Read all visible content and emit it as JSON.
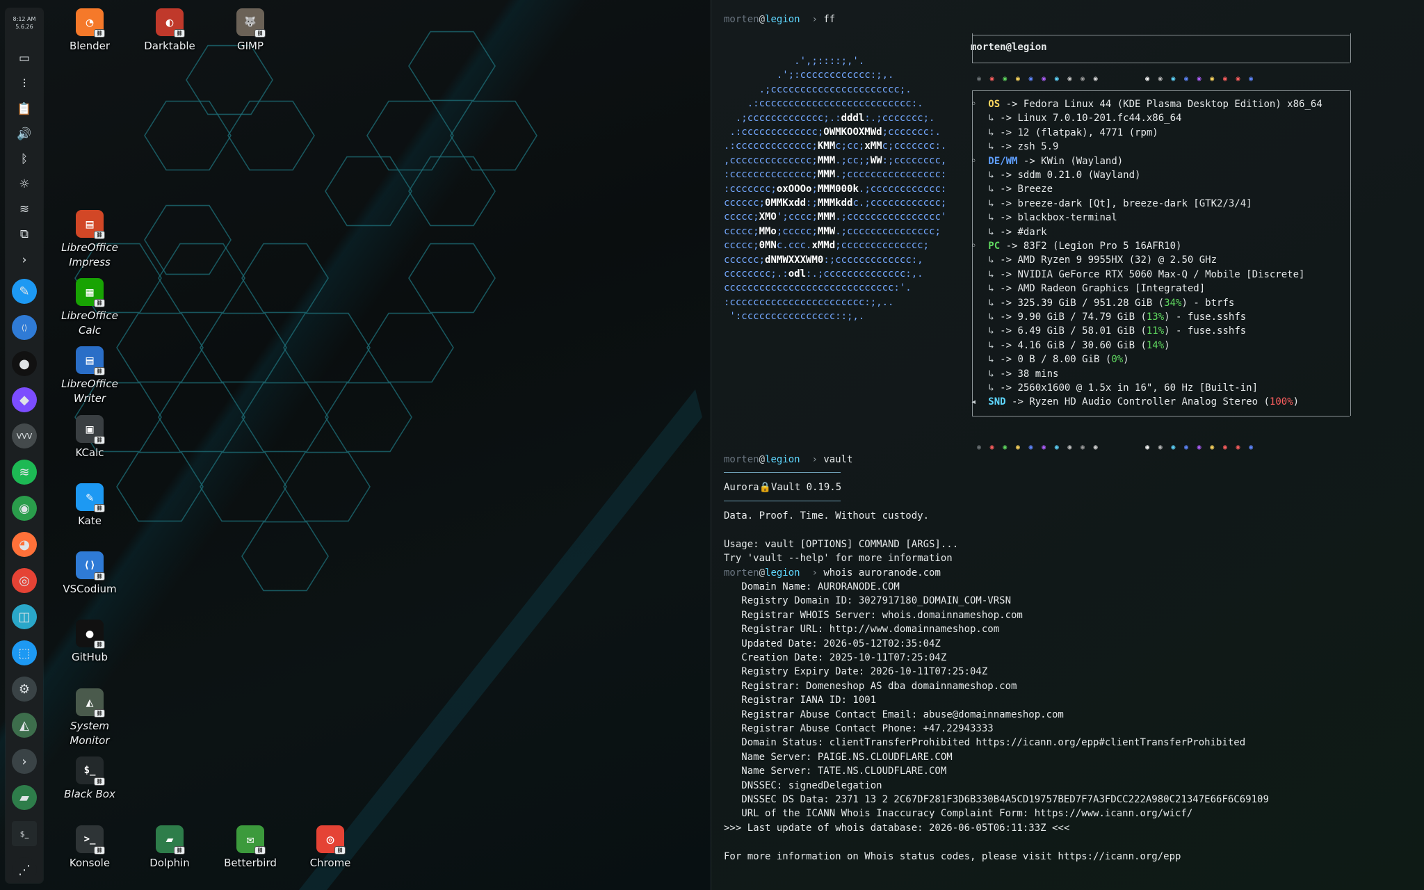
{
  "panel": {
    "clock_time": "8:12 AM",
    "clock_date": "5.6.26",
    "items": [
      {
        "name": "show-desktop-icon",
        "glyph": "▭"
      },
      {
        "name": "mixer-icon",
        "glyph": "⫶"
      },
      {
        "name": "clipboard-icon",
        "glyph": "📋"
      },
      {
        "name": "volume-icon",
        "glyph": "🔊"
      },
      {
        "name": "bluetooth-icon",
        "glyph": "ᛒ"
      },
      {
        "name": "brightness-icon",
        "glyph": "☼"
      },
      {
        "name": "wifi-icon",
        "glyph": "≋"
      },
      {
        "name": "display-icon",
        "glyph": "⧉"
      },
      {
        "name": "expand-arrow-icon",
        "glyph": "›"
      }
    ],
    "apps": [
      {
        "name": "kate-app-icon",
        "glyph": "✎",
        "color": "#1d99f3"
      },
      {
        "name": "vscodium-app-icon",
        "glyph": "⟨⟩",
        "color": "#2f7bd6"
      },
      {
        "name": "github-app-icon",
        "glyph": "●",
        "color": "#111111"
      },
      {
        "name": "obsidian-app-icon",
        "glyph": "◆",
        "color": "#7c4dff"
      },
      {
        "name": "vim-app-icon",
        "glyph": "VVV",
        "color": "#444a4c"
      },
      {
        "name": "spotify-app-icon",
        "glyph": "≋",
        "color": "#1db954"
      },
      {
        "name": "kdeconnect-app-icon",
        "glyph": "◉",
        "color": "#2a9d4b"
      },
      {
        "name": "firefox-app-icon",
        "glyph": "◕",
        "color": "#ff7139"
      },
      {
        "name": "chrome-app-icon",
        "glyph": "◎",
        "color": "#e54335"
      },
      {
        "name": "screenshot-app-icon",
        "glyph": "◫",
        "color": "#2aa7c9"
      },
      {
        "name": "discover-app-icon",
        "glyph": "⬚",
        "color": "#1d99f3"
      },
      {
        "name": "settings-app-icon",
        "glyph": "⚙",
        "color": "#3a4346"
      },
      {
        "name": "system-monitor-app-icon",
        "glyph": "◭",
        "color": "#3d6e4c"
      },
      {
        "name": "terminal-arrow-app-icon",
        "glyph": "›",
        "color": "#3a4346"
      },
      {
        "name": "dolphin-app-icon",
        "glyph": "▰",
        "color": "#2e7d4a"
      },
      {
        "name": "blackbox-app-icon",
        "glyph": "$_",
        "color": "#23292b"
      },
      {
        "name": "launcher-app-icon",
        "glyph": "⋰",
        "color": "#1b1f21"
      }
    ]
  },
  "desktop": {
    "icons": [
      {
        "label": "Blender",
        "glyph": "◔",
        "color": "#f5792a"
      },
      {
        "label": "Darktable",
        "glyph": "◐",
        "color": "#c0392b"
      },
      {
        "label": "GIMP",
        "glyph": "🐺",
        "color": "#6b6257"
      },
      {
        "label": "LibreOffice\nImpress",
        "glyph": "▤",
        "color": "#d24726"
      },
      {
        "label": "LibreOffice\nCalc",
        "glyph": "▦",
        "color": "#18a303"
      },
      {
        "label": "LibreOffice\nWriter",
        "glyph": "▤",
        "color": "#2a6ec7"
      },
      {
        "label": "KCalc",
        "glyph": "▣",
        "color": "#3a3f42"
      },
      {
        "label": "Kate",
        "glyph": "✎",
        "color": "#1d99f3"
      },
      {
        "label": "VSCodium",
        "glyph": "⟨⟩",
        "color": "#2f7bd6"
      },
      {
        "label": "GitHub",
        "glyph": "●",
        "color": "#111111"
      },
      {
        "label": "System\nMonitor",
        "glyph": "◭",
        "color": "#4a5a4c"
      },
      {
        "label": "Black Box",
        "glyph": "$_",
        "color": "#23292b"
      },
      {
        "label": "Konsole",
        "glyph": ">_",
        "color": "#2e3436"
      },
      {
        "label": "Dolphin",
        "glyph": "▰",
        "color": "#2e7d4a"
      },
      {
        "label": "Betterbird",
        "glyph": "✉",
        "color": "#3c9a3c"
      },
      {
        "label": "Chrome",
        "glyph": "◎",
        "color": "#e54335"
      }
    ]
  },
  "terminal": {
    "prompt": {
      "user": "morten",
      "at": "@",
      "host": "legion",
      "arrow": "›"
    },
    "cmd_ff": "ff",
    "ff": {
      "header": "morten@legion",
      "logo": [
        "            .',;::::;,'.",
        "         .';:cccccccccccc:;,.",
        "      .;cccccccccccccccccccccc;.",
        "    .:cccccccccccccccccccccccccc:.",
        "  .;ccccccccccccc;.:dddl:.;ccccccc;.",
        " .:ccccccccccccc;OWMKOOXMWd;ccccccc:.",
        ".:ccccccccccccc;KMMc;cc;xMMc;ccccccc:.",
        ",cccccccccccccc;MMM.;cc;;WW:;cccccccc,",
        ":cccccccccccccc;MMM.;cccccccccccccccc:",
        ":ccccccc;oxOOOo;MMM000k.;cccccccccccc:",
        "cccccc;0MMKxdd:;MMMkddc.;cccccccccccc;",
        "ccccc;XMO';cccc;MMM.;cccccccccccccccc'",
        "ccccc;MMo;ccccc;MMW.;ccccccccccccccc;",
        "ccccc;0MNc.ccc.xMMd;cccccccccccccc;",
        "cccccc;dNMWXXXWM0:;ccccccccccccc:,",
        "cccccccc;.:odl:.;cccccccccccccc:,.",
        "ccccccccccccccccccccccccccccc:'.",
        ":ccccccccccccccccccccccc:;,..",
        " ':cccccccccccccccc::;,."
      ],
      "rows": [
        {
          "label": "OS",
          "cls": "lbl-os",
          "text": "-> Fedora Linux 44 (KDE Plasma Desktop Edition) x86_64"
        },
        {
          "label": "",
          "text": "-> Linux 7.0.10-201.fc44.x86_64"
        },
        {
          "label": "",
          "text": "-> 12 (flatpak), 4771 (rpm)"
        },
        {
          "label": "",
          "text": "-> zsh 5.9"
        },
        {
          "label": "DE/WM",
          "cls": "lbl-de",
          "text": "-> KWin (Wayland)"
        },
        {
          "label": "",
          "text": "-> sddm 0.21.0 (Wayland)"
        },
        {
          "label": "",
          "text": "-> Breeze"
        },
        {
          "label": "",
          "text": "-> breeze-dark [Qt], breeze-dark [GTK2/3/4]"
        },
        {
          "label": "",
          "text": "-> blackbox-terminal"
        },
        {
          "label": "",
          "text": "-> #dark"
        },
        {
          "label": "PC",
          "cls": "lbl-pc",
          "text": "-> 83F2 (Legion Pro 5 16AFR10)"
        },
        {
          "label": "",
          "text": "-> AMD Ryzen 9 9955HX (32) @ 2.50 GHz"
        },
        {
          "label": "",
          "text": "-> NVIDIA GeForce RTX 5060 Max-Q / Mobile [Discrete]"
        },
        {
          "label": "",
          "text": "-> AMD Radeon Graphics [Integrated]"
        },
        {
          "label": "",
          "text": "-> 325.39 GiB / 951.28 GiB (",
          "pct": "34%",
          "pcls": "pct-g",
          "tail": ") - btrfs"
        },
        {
          "label": "",
          "text": "-> 9.90 GiB / 74.79 GiB (",
          "pct": "13%",
          "pcls": "pct-g",
          "tail": ") - fuse.sshfs"
        },
        {
          "label": "",
          "text": "-> 6.49 GiB / 58.01 GiB (",
          "pct": "11%",
          "pcls": "pct-g",
          "tail": ") - fuse.sshfs"
        },
        {
          "label": "",
          "text": "-> 4.16 GiB / 30.60 GiB (",
          "pct": "14%",
          "pcls": "pct-g",
          "tail": ")"
        },
        {
          "label": "",
          "text": "-> 0 B / 8.00 GiB (",
          "pct": "0%",
          "pcls": "pct-g",
          "tail": ")"
        },
        {
          "label": "",
          "text": "-> 38 mins"
        },
        {
          "label": "",
          "text": "-> 2560x1600 @ 1.5x in 16\", 60 Hz [Built-in]"
        },
        {
          "label": "SND",
          "cls": "lbl-snd",
          "text": "-> Ryzen HD Audio Controller Analog Stereo (",
          "pct": "100%",
          "pcls": "pct-r",
          "tail": ")"
        }
      ],
      "palette": [
        "#6b7275",
        "#ff5f5f",
        "#5fd75f",
        "#ffd75f",
        "#5f87ff",
        "#af5fff",
        "#5fd7ff",
        "#c6c6c6",
        "#9e9e9e",
        "#dadada",
        "#ffffff",
        "#bcbcbc",
        "#5fd7ff",
        "#5f87ff",
        "#af5fff",
        "#ffd75f",
        "#ff5f5f",
        "#ff5f5f",
        "#5f87ff"
      ]
    },
    "cmd_vault": "vault",
    "vault": {
      "title": "Aurora🔒Vault 0.19.5",
      "tagline": "Data. Proof. Time. Without custody.",
      "usage": "Usage: vault [OPTIONS] COMMAND [ARGS]...",
      "help": "Try 'vault --help' for more information"
    },
    "cmd_whois": "whois auroranode.com",
    "whois": [
      "   Domain Name: AURORANODE.COM",
      "   Registry Domain ID: 3027917180_DOMAIN_COM-VRSN",
      "   Registrar WHOIS Server: whois.domainnameshop.com",
      "   Registrar URL: http://www.domainnameshop.com",
      "   Updated Date: 2026-05-12T02:35:04Z",
      "   Creation Date: 2025-10-11T07:25:04Z",
      "   Registry Expiry Date: 2026-10-11T07:25:04Z",
      "   Registrar: Domeneshop AS dba domainnameshop.com",
      "   Registrar IANA ID: 1001",
      "   Registrar Abuse Contact Email: abuse@domainnameshop.com",
      "   Registrar Abuse Contact Phone: +47.22943333",
      "   Domain Status: clientTransferProhibited https://icann.org/epp#clientTransferProhibited",
      "   Name Server: PAIGE.NS.CLOUDFLARE.COM",
      "   Name Server: TATE.NS.CLOUDFLARE.COM",
      "   DNSSEC: signedDelegation",
      "   DNSSEC DS Data: 2371 13 2 2C67DF281F3D6B330B4A5CD19757BED7F7A3FDCC222A980C21347E66F6C69109",
      "   URL of the ICANN Whois Inaccuracy Complaint Form: https://www.icann.org/wicf/",
      ">>> Last update of whois database: 2026-06-05T06:11:33Z <<<",
      "",
      "For more information on Whois status codes, please visit https://icann.org/epp"
    ]
  }
}
